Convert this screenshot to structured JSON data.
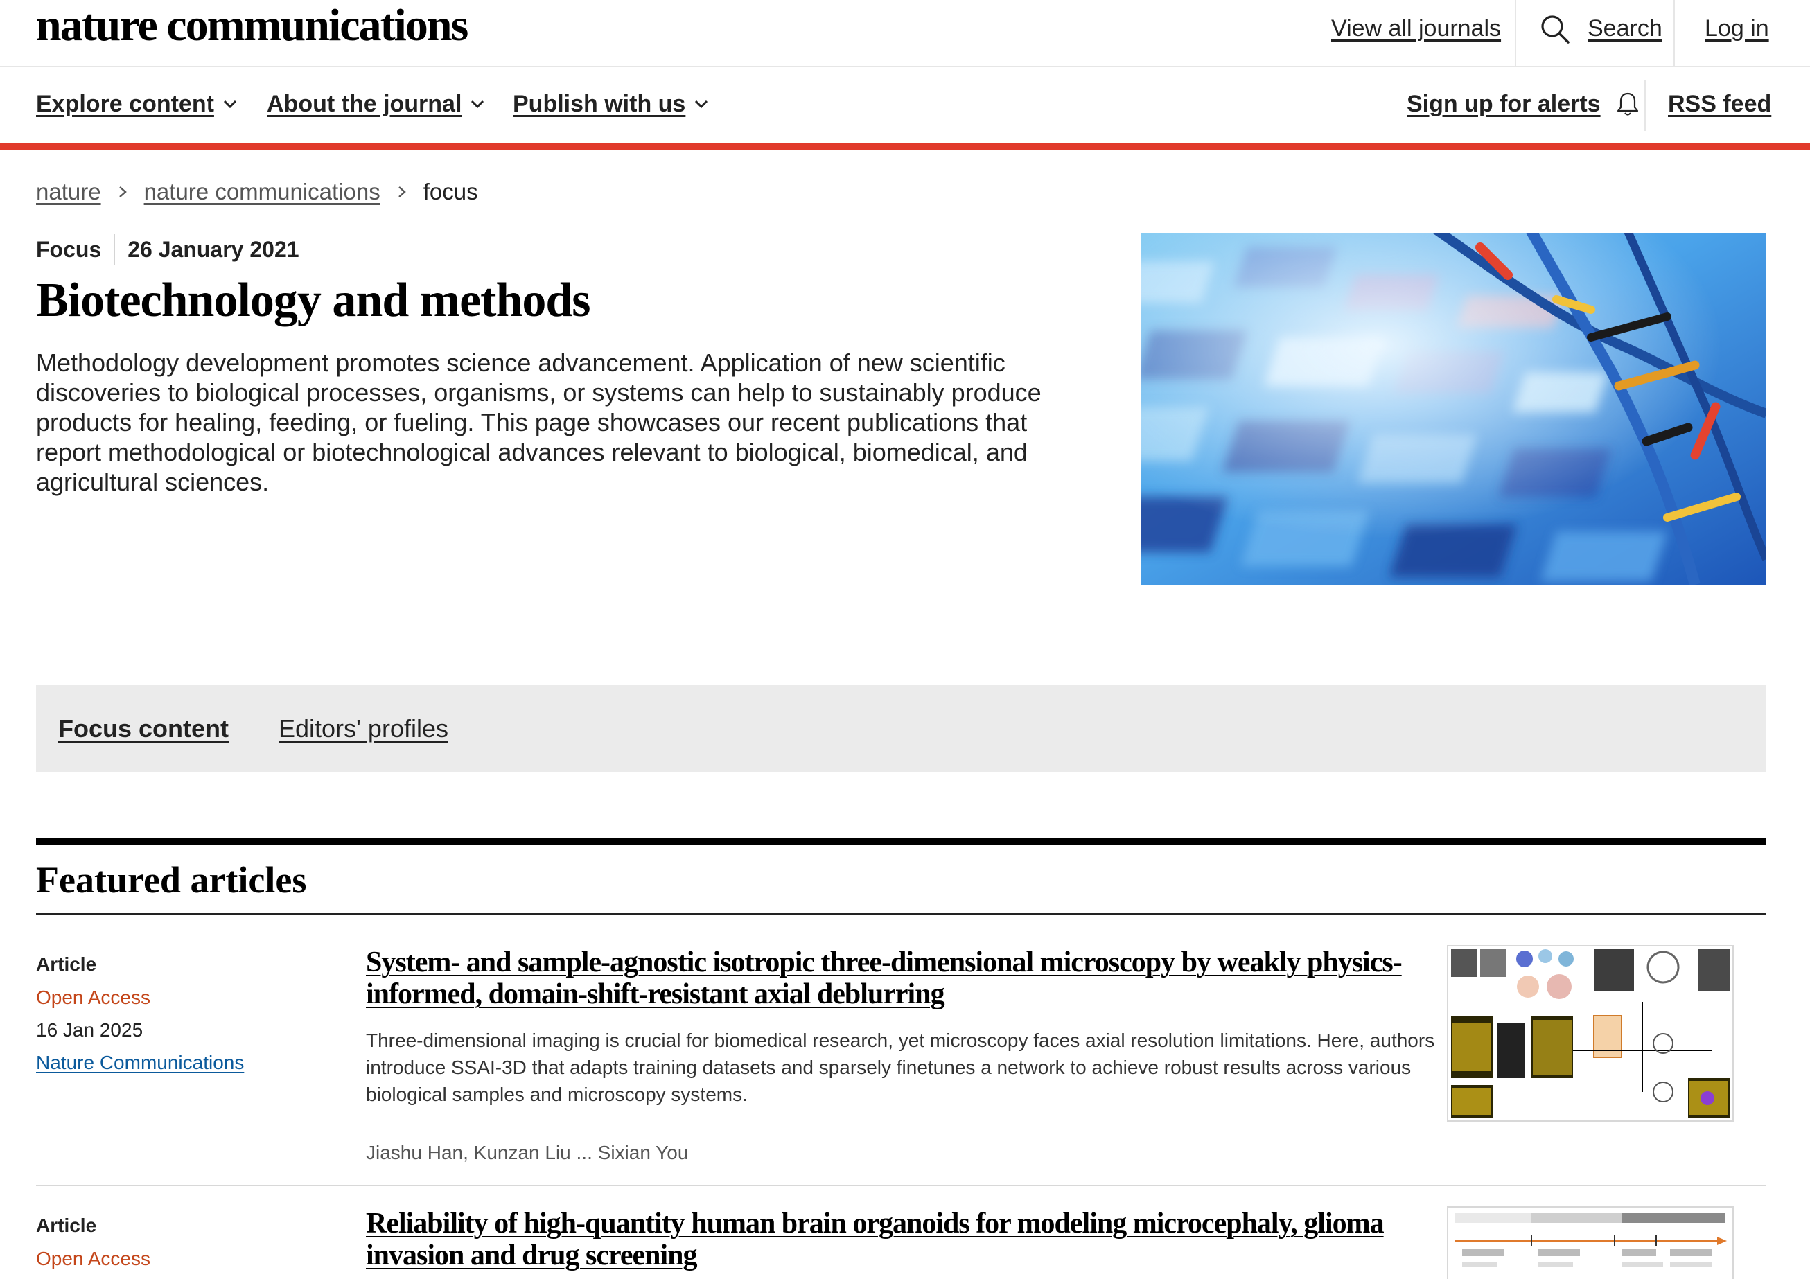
{
  "header": {
    "logo": "nature communications",
    "view_all_journals": "View all journals",
    "search": "Search",
    "login": "Log in"
  },
  "nav": {
    "explore": "Explore content",
    "about": "About the journal",
    "publish": "Publish with us",
    "alerts": "Sign up for alerts",
    "rss": "RSS feed"
  },
  "breadcrumb": {
    "items": [
      "nature",
      "nature communications"
    ],
    "current": "focus"
  },
  "hero": {
    "type": "Focus",
    "date": "26 January 2021",
    "title": "Biotechnology and methods",
    "description": "Methodology development promotes science advancement. Application of new scientific discoveries to biological processes, organisms, or systems can help to sustainably produce products for healing, feeding, or fueling. This page showcases our recent publications that report methodological or biotechnological advances relevant to biological, biomedical, and agricultural sciences."
  },
  "tabs": {
    "focus_content": "Focus content",
    "editors_profiles": "Editors' profiles"
  },
  "featured": {
    "title": "Featured articles",
    "articles": [
      {
        "type": "Article",
        "access": "Open Access",
        "date": "16 Jan 2025",
        "journal": "Nature Communications",
        "title": "System- and sample-agnostic isotropic three-dimensional microscopy by weakly physics-informed, domain-shift-resistant axial deblurring",
        "abstract": "Three-dimensional imaging is crucial for biomedical research, yet microscopy faces axial resolution limitations. Here, authors introduce SSAI-3D that adapts training datasets and sparsely finetunes a network to achieve robust results across various biological samples and microscopy systems.",
        "authors": "Jiashu Han, Kunzan Liu ... Sixian You"
      },
      {
        "type": "Article",
        "access": "Open Access",
        "title": "Reliability of high-quantity human brain organoids for modeling microcephaly, glioma invasion and drug screening"
      }
    ]
  },
  "colors": {
    "accent_bar": "#e13a2b",
    "open_access": "#c4461a",
    "journal_link": "#0b5a9c",
    "tabs_background": "#ebebeb"
  }
}
